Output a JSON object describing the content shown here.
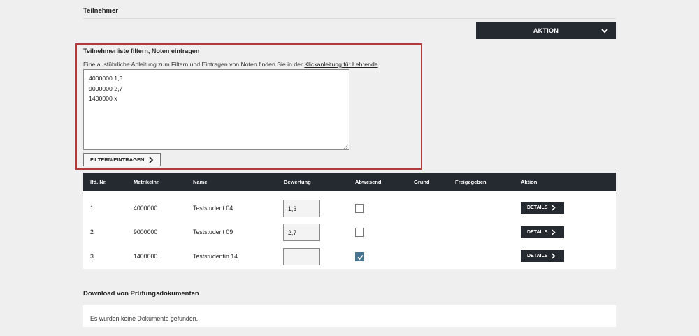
{
  "page": {
    "section_title": "Teilnehmer",
    "action_menu_label": "AKTION"
  },
  "filter": {
    "title": "Teilnehmerliste filtern, Noten eintragen",
    "description_prefix": "Eine ausführliche Anleitung zum Filtern und Eintragen von Noten finden Sie in der ",
    "link_text": "Klickanleitung für Lehrende",
    "description_suffix": ".",
    "textarea_value": "4000000 1,3\n9000000 2,7\n1400000 x",
    "button_label": "FILTERN/EINTRAGEN"
  },
  "table": {
    "headers": {
      "lfd": "lfd. Nr.",
      "matrikel": "Matrikelnr.",
      "name": "Name",
      "bewertung": "Bewertung",
      "abwesend": "Abwesend",
      "grund": "Grund",
      "freigegeben": "Freigegeben",
      "aktion": "Aktion"
    },
    "rows": [
      {
        "nr": "1",
        "matrikel": "4000000",
        "name": "Teststudent 04",
        "grade": "1,3",
        "absent": false,
        "action": "DETAILS"
      },
      {
        "nr": "2",
        "matrikel": "9000000",
        "name": "Teststudent 09",
        "grade": "2,7",
        "absent": false,
        "action": "DETAILS"
      },
      {
        "nr": "3",
        "matrikel": "1400000",
        "name": "Teststudentin 14",
        "grade": "",
        "absent": true,
        "action": "DETAILS"
      }
    ]
  },
  "downloads": {
    "title": "Download von Prüfungsdokumenten",
    "empty_message": "Es wurden keine Dokumente gefunden."
  },
  "colors": {
    "dark": "#252a30",
    "highlight_border": "#b33a3a",
    "checkbox_checked": "#4a7590"
  }
}
